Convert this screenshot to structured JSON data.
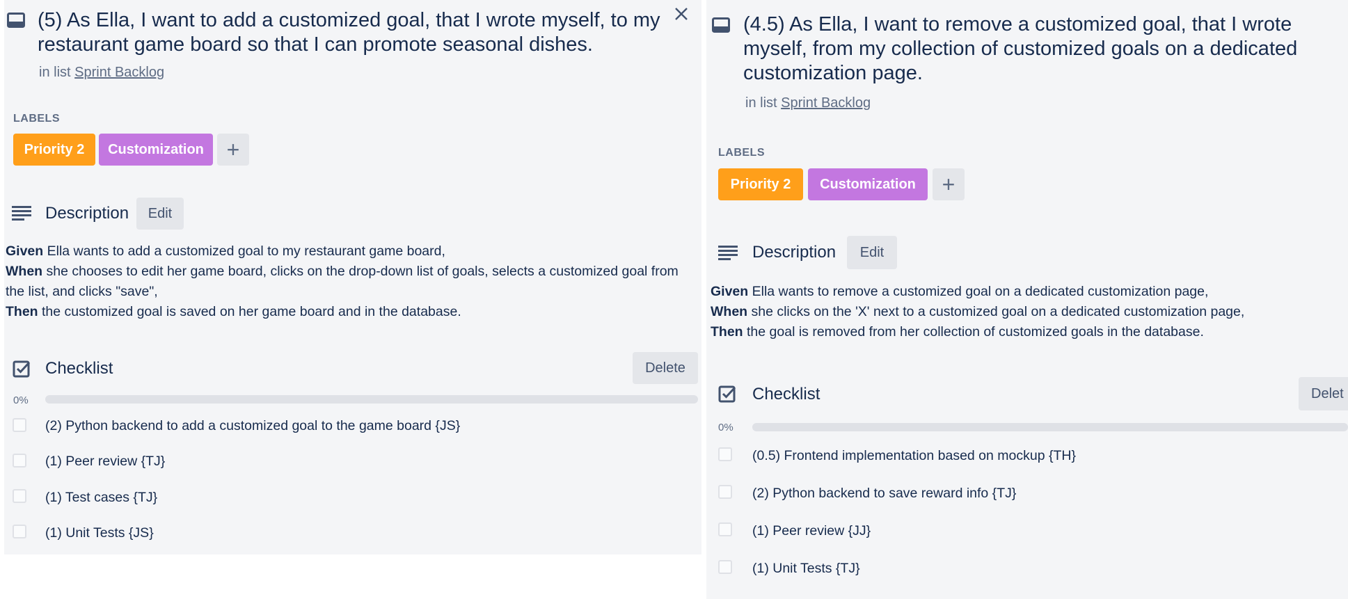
{
  "cards": [
    {
      "title": "(5) As Ella, I want to add a customized goal, that I wrote myself, to my restaurant game board so that I can promote seasonal dishes.",
      "in_list_prefix": "in list",
      "list_name": "Sprint Backlog",
      "labels_heading": "LABELS",
      "labels": [
        {
          "text": "Priority 2",
          "color": "#ff9f1a"
        },
        {
          "text": "Customization",
          "color": "#c377e0"
        }
      ],
      "add_label_glyph": "+",
      "description_heading": "Description",
      "edit_label": "Edit",
      "description": {
        "given_kw": "Given",
        "given": " Ella wants to add a customized goal to my restaurant game board,",
        "when_kw": "When",
        "when": " she chooses to edit her game board, clicks on the drop-down list of goals, selects a customized goal from the list, and clicks \"save\",",
        "then_kw": "Then",
        "then": " the customized goal is saved on her game board and in the database."
      },
      "checklist_heading": "Checklist",
      "delete_label": "Delete",
      "progress_text": "0%",
      "progress": 0,
      "items": [
        "(2) Python backend to add a customized goal to the game board {JS}",
        "(1) Peer review {TJ}",
        "(1) Test cases {TJ}",
        "(1) Unit Tests {JS}"
      ],
      "close_icon": "close-icon"
    },
    {
      "title": "(4.5) As Ella, I want to remove a customized goal, that I wrote myself, from my collection of customized goals on a dedicated customization page.",
      "in_list_prefix": "in list",
      "list_name": "Sprint Backlog",
      "labels_heading": "LABELS",
      "labels": [
        {
          "text": "Priority 2",
          "color": "#ff9f1a"
        },
        {
          "text": "Customization",
          "color": "#c377e0"
        }
      ],
      "add_label_glyph": "+",
      "description_heading": "Description",
      "edit_label": "Edit",
      "description": {
        "given_kw": "Given",
        "given": " Ella wants to remove a customized goal on a dedicated customization page,",
        "when_kw": "When",
        "when": " she clicks on the 'X' next to a customized goal on a dedicated customization page,",
        "then_kw": "Then",
        "then": " the goal is removed from her collection of customized goals in the database."
      },
      "checklist_heading": "Checklist",
      "delete_label": "Delet",
      "progress_text": "0%",
      "progress": 0,
      "items": [
        "(0.5) Frontend implementation based on mockup {TH}",
        "(2) Python backend to save reward info {TJ}",
        "(1) Peer review {JJ}",
        "(1) Unit Tests {TJ}"
      ]
    }
  ]
}
